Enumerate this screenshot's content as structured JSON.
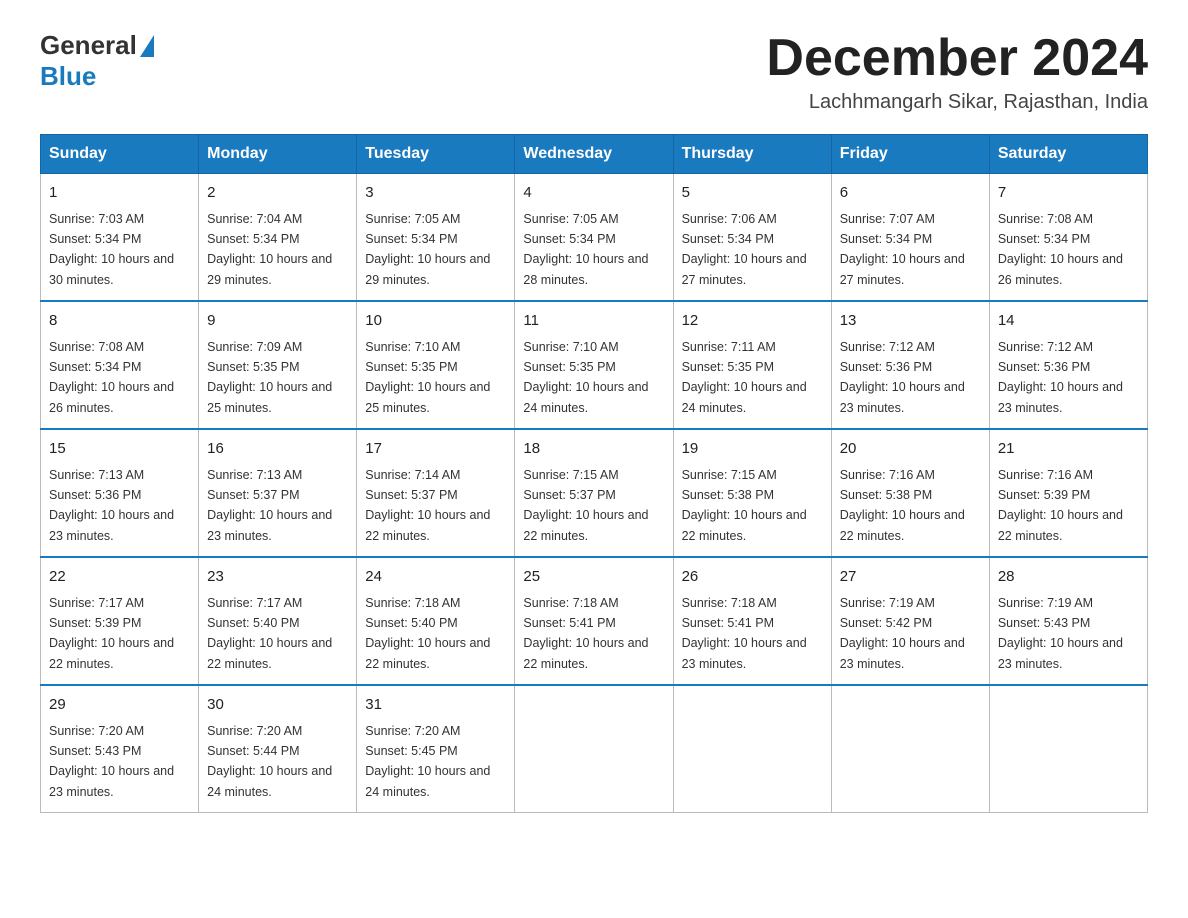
{
  "header": {
    "logo_general": "General",
    "logo_blue": "Blue",
    "month_title": "December 2024",
    "location": "Lachhmangarh Sikar, Rajasthan, India"
  },
  "weekdays": [
    "Sunday",
    "Monday",
    "Tuesday",
    "Wednesday",
    "Thursday",
    "Friday",
    "Saturday"
  ],
  "weeks": [
    [
      {
        "day": "1",
        "sunrise": "7:03 AM",
        "sunset": "5:34 PM",
        "daylight": "10 hours and 30 minutes."
      },
      {
        "day": "2",
        "sunrise": "7:04 AM",
        "sunset": "5:34 PM",
        "daylight": "10 hours and 29 minutes."
      },
      {
        "day": "3",
        "sunrise": "7:05 AM",
        "sunset": "5:34 PM",
        "daylight": "10 hours and 29 minutes."
      },
      {
        "day": "4",
        "sunrise": "7:05 AM",
        "sunset": "5:34 PM",
        "daylight": "10 hours and 28 minutes."
      },
      {
        "day": "5",
        "sunrise": "7:06 AM",
        "sunset": "5:34 PM",
        "daylight": "10 hours and 27 minutes."
      },
      {
        "day": "6",
        "sunrise": "7:07 AM",
        "sunset": "5:34 PM",
        "daylight": "10 hours and 27 minutes."
      },
      {
        "day": "7",
        "sunrise": "7:08 AM",
        "sunset": "5:34 PM",
        "daylight": "10 hours and 26 minutes."
      }
    ],
    [
      {
        "day": "8",
        "sunrise": "7:08 AM",
        "sunset": "5:34 PM",
        "daylight": "10 hours and 26 minutes."
      },
      {
        "day": "9",
        "sunrise": "7:09 AM",
        "sunset": "5:35 PM",
        "daylight": "10 hours and 25 minutes."
      },
      {
        "day": "10",
        "sunrise": "7:10 AM",
        "sunset": "5:35 PM",
        "daylight": "10 hours and 25 minutes."
      },
      {
        "day": "11",
        "sunrise": "7:10 AM",
        "sunset": "5:35 PM",
        "daylight": "10 hours and 24 minutes."
      },
      {
        "day": "12",
        "sunrise": "7:11 AM",
        "sunset": "5:35 PM",
        "daylight": "10 hours and 24 minutes."
      },
      {
        "day": "13",
        "sunrise": "7:12 AM",
        "sunset": "5:36 PM",
        "daylight": "10 hours and 23 minutes."
      },
      {
        "day": "14",
        "sunrise": "7:12 AM",
        "sunset": "5:36 PM",
        "daylight": "10 hours and 23 minutes."
      }
    ],
    [
      {
        "day": "15",
        "sunrise": "7:13 AM",
        "sunset": "5:36 PM",
        "daylight": "10 hours and 23 minutes."
      },
      {
        "day": "16",
        "sunrise": "7:13 AM",
        "sunset": "5:37 PM",
        "daylight": "10 hours and 23 minutes."
      },
      {
        "day": "17",
        "sunrise": "7:14 AM",
        "sunset": "5:37 PM",
        "daylight": "10 hours and 22 minutes."
      },
      {
        "day": "18",
        "sunrise": "7:15 AM",
        "sunset": "5:37 PM",
        "daylight": "10 hours and 22 minutes."
      },
      {
        "day": "19",
        "sunrise": "7:15 AM",
        "sunset": "5:38 PM",
        "daylight": "10 hours and 22 minutes."
      },
      {
        "day": "20",
        "sunrise": "7:16 AM",
        "sunset": "5:38 PM",
        "daylight": "10 hours and 22 minutes."
      },
      {
        "day": "21",
        "sunrise": "7:16 AM",
        "sunset": "5:39 PM",
        "daylight": "10 hours and 22 minutes."
      }
    ],
    [
      {
        "day": "22",
        "sunrise": "7:17 AM",
        "sunset": "5:39 PM",
        "daylight": "10 hours and 22 minutes."
      },
      {
        "day": "23",
        "sunrise": "7:17 AM",
        "sunset": "5:40 PM",
        "daylight": "10 hours and 22 minutes."
      },
      {
        "day": "24",
        "sunrise": "7:18 AM",
        "sunset": "5:40 PM",
        "daylight": "10 hours and 22 minutes."
      },
      {
        "day": "25",
        "sunrise": "7:18 AM",
        "sunset": "5:41 PM",
        "daylight": "10 hours and 22 minutes."
      },
      {
        "day": "26",
        "sunrise": "7:18 AM",
        "sunset": "5:41 PM",
        "daylight": "10 hours and 23 minutes."
      },
      {
        "day": "27",
        "sunrise": "7:19 AM",
        "sunset": "5:42 PM",
        "daylight": "10 hours and 23 minutes."
      },
      {
        "day": "28",
        "sunrise": "7:19 AM",
        "sunset": "5:43 PM",
        "daylight": "10 hours and 23 minutes."
      }
    ],
    [
      {
        "day": "29",
        "sunrise": "7:20 AM",
        "sunset": "5:43 PM",
        "daylight": "10 hours and 23 minutes."
      },
      {
        "day": "30",
        "sunrise": "7:20 AM",
        "sunset": "5:44 PM",
        "daylight": "10 hours and 24 minutes."
      },
      {
        "day": "31",
        "sunrise": "7:20 AM",
        "sunset": "5:45 PM",
        "daylight": "10 hours and 24 minutes."
      },
      null,
      null,
      null,
      null
    ]
  ]
}
